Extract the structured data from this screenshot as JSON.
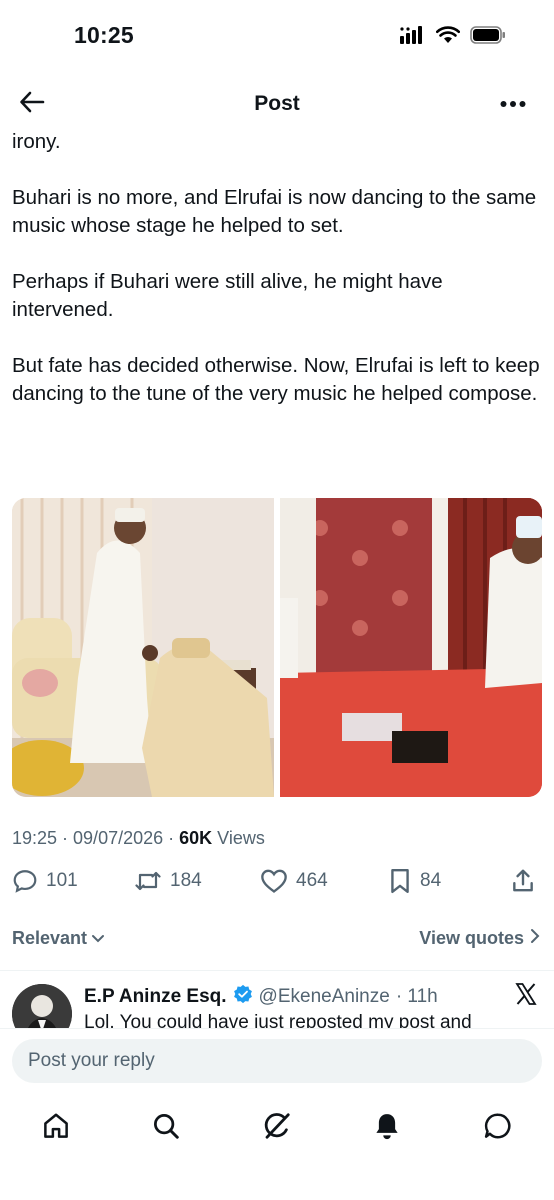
{
  "status_bar": {
    "time": "10:25"
  },
  "header": {
    "title": "Post"
  },
  "post": {
    "paragraphs": [
      "irony.",
      "Buhari is no more, and Elrufai is now dancing to the same music whose stage he helped to set.",
      "Perhaps if Buhari were still alive, he might have intervened.",
      "But fate has decided otherwise. Now, Elrufai is left to keep dancing to the tune of the very music he helped compose."
    ],
    "meta": {
      "time_date": "19:25 · 09/07/2026 · ",
      "views_count": "60K",
      "views_label": " Views"
    },
    "stats": {
      "replies": "101",
      "reposts": "184",
      "likes": "464",
      "bookmarks": "84"
    }
  },
  "sort": {
    "relevant_label": "Relevant",
    "view_quotes_label": "View quotes"
  },
  "reply": {
    "name": "E.P Aninze Esq.",
    "handle": "@EkeneAninze",
    "time": "· 11h",
    "text": "Lol. You could have just reposted my post and"
  },
  "reply_bar": {
    "placeholder": "Post your reply"
  },
  "colors": {
    "text": "#0f1419",
    "muted": "#536471",
    "verified": "#1d9bf0",
    "input_bg": "#eff3f4"
  },
  "icons": {
    "back": "arrow-left-icon",
    "more": "more-icon",
    "reply": "comment-icon",
    "repost": "repost-icon",
    "like": "heart-icon",
    "bookmark": "bookmark-icon",
    "share": "share-icon",
    "home": "home-icon",
    "search": "search-icon",
    "grok": "grok-icon",
    "notifications": "bell-icon",
    "messages": "chat-icon"
  }
}
